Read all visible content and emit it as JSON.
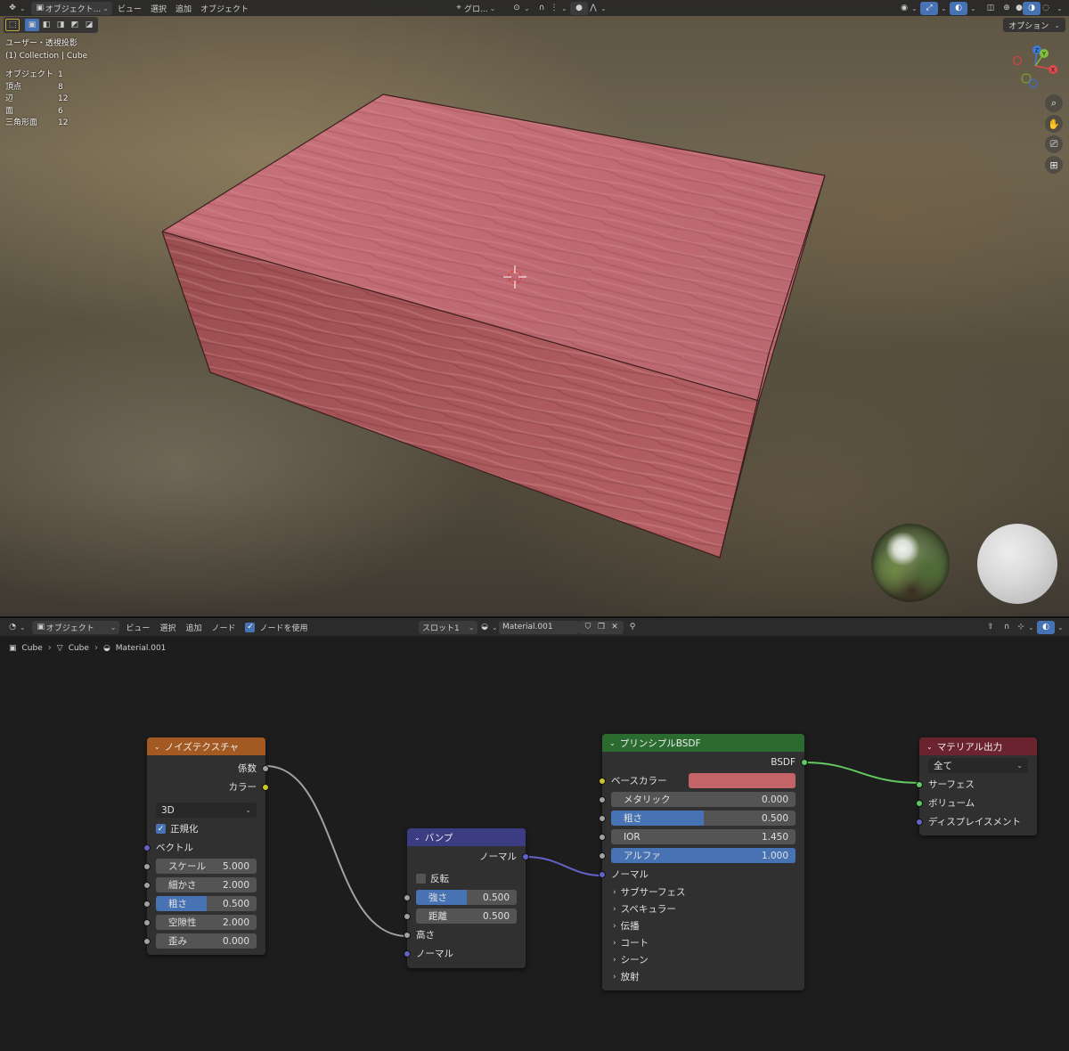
{
  "viewport": {
    "header": {
      "mode": "オブジェクト...",
      "menus": [
        "ビュー",
        "選択",
        "追加",
        "オブジェクト"
      ],
      "transform": "グロ..."
    },
    "options": "オプション",
    "overlay": {
      "view_name": "ユーザー・透視投影",
      "collection": "(1) Collection | Cube"
    },
    "stats": [
      {
        "label": "オブジェクト",
        "value": "1"
      },
      {
        "label": "頂点",
        "value": "8"
      },
      {
        "label": "辺",
        "value": "12"
      },
      {
        "label": "面",
        "value": "6"
      },
      {
        "label": "三角形面",
        "value": "12"
      }
    ],
    "gizmo": {
      "z": "Z",
      "y": "Y",
      "x": "X"
    }
  },
  "node_editor": {
    "header": {
      "mode": "オブジェクト",
      "menus": [
        "ビュー",
        "選択",
        "追加",
        "ノード"
      ],
      "use_nodes": "ノードを使用",
      "slot": "スロット1",
      "material": "Material.001"
    },
    "breadcrumb": [
      "Cube",
      "Cube",
      "Material.001"
    ],
    "noise": {
      "title": "ノイズテクスチャ",
      "color": "#a35a22",
      "out_fac": "係数",
      "out_color": "カラー",
      "dimension": "3D",
      "normalize": "正規化",
      "vector": "ベクトル",
      "fields": [
        {
          "label": "スケール",
          "value": "5.000",
          "fill": 0
        },
        {
          "label": "細かさ",
          "value": "2.000",
          "fill": 0
        },
        {
          "label": "粗さ",
          "value": "0.500",
          "fill": 0.5
        },
        {
          "label": "空隙性",
          "value": "2.000",
          "fill": 0
        },
        {
          "label": "歪み",
          "value": "0.000",
          "fill": 0
        }
      ]
    },
    "bump": {
      "title": "バンプ",
      "color": "#3c3c83",
      "out_normal": "ノーマル",
      "invert": "反転",
      "fields": [
        {
          "label": "強さ",
          "value": "0.500",
          "fill": 0.5
        },
        {
          "label": "距離",
          "value": "0.500",
          "fill": 0
        }
      ],
      "in_height": "高さ",
      "in_normal": "ノーマル"
    },
    "bsdf": {
      "title": "プリンシプルBSDF",
      "color": "#2b6b30",
      "out_bsdf": "BSDF",
      "base_color_label": "ベースカラー",
      "base_color": "#c46468",
      "fields": [
        {
          "label": "メタリック",
          "value": "0.000",
          "fill": 0
        },
        {
          "label": "粗さ",
          "value": "0.500",
          "fill": 0.5
        },
        {
          "label": "IOR",
          "value": "1.450",
          "fill": 0
        },
        {
          "label": "アルファ",
          "value": "1.000",
          "fill": 1
        }
      ],
      "normal": "ノーマル",
      "panels": [
        "サブサーフェス",
        "スペキュラー",
        "伝播",
        "コート",
        "シーン",
        "放射"
      ]
    },
    "output": {
      "title": "マテリアル出力",
      "color": "#6b2330",
      "target": "全て",
      "inputs": [
        "サーフェス",
        "ボリューム",
        "ディスプレイスメント"
      ]
    }
  }
}
